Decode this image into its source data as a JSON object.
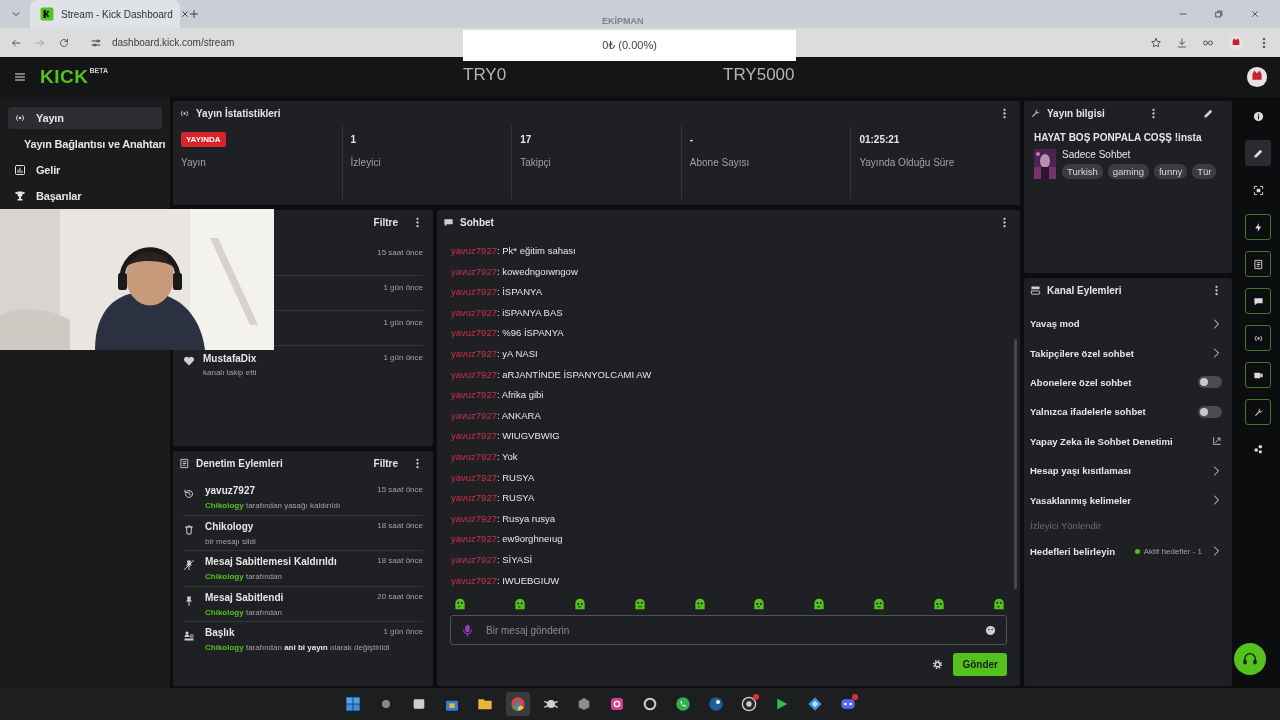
{
  "browser": {
    "tabs": [
      {
        "title": "Stream - Kick Dashboard",
        "selected": true
      }
    ],
    "nav_buttons": [
      {
        "kind": "back",
        "disabled": false
      },
      {
        "kind": "forward",
        "disabled": true
      },
      {
        "kind": "reload",
        "disabled": false
      }
    ],
    "url": "dashboard.kick.com/stream"
  },
  "overlay": {
    "label": "EKİPMAN",
    "progress_text": "0₺ (0.00%)",
    "level": 0,
    "min": "TRY0",
    "max": "TRY5000"
  },
  "header": {
    "logo": "KICK",
    "logo_badge": "BETA"
  },
  "sidebar": {
    "items": [
      {
        "kind": "stream",
        "label": "Yayın",
        "selected": true
      },
      {
        "kind": "sub",
        "label": "Yayın Bağlantısı ve Anahtarı",
        "selected": false
      },
      {
        "kind": "revenue",
        "label": "Gelir",
        "selected": false
      },
      {
        "kind": "achievements",
        "label": "Başarılar",
        "selected": false
      }
    ]
  },
  "stats": {
    "title": "Yayın İstatistikleri",
    "cells": [
      {
        "kind": "badge",
        "value": "YAYINDA",
        "label": "Yayın"
      },
      {
        "kind": "number",
        "value": "1",
        "label": "İzleyici"
      },
      {
        "kind": "number",
        "value": "17",
        "label": "Takipçi"
      },
      {
        "kind": "number",
        "value": "-",
        "label": "Abone Sayısı"
      },
      {
        "kind": "number",
        "value": "01:25:21",
        "label": "Yayında Olduğu Süre"
      }
    ]
  },
  "activity": {
    "filter": "Filtre",
    "items": [
      {
        "time": "15 saat önce"
      },
      {
        "time": "1 gün önce"
      },
      {
        "time": "1 gün önce"
      },
      {
        "name": "MustafaDix",
        "action": "kanalı takip etti",
        "time": "1 gün önce"
      }
    ]
  },
  "moderation": {
    "title": "Denetim Eylemleri",
    "filter": "Filtre",
    "items": [
      {
        "kind": "unban",
        "title": "yavuz7927",
        "actor": "Chikology",
        "detail": "tarafından yasağı kaldırıldı",
        "time": "15 saat önce"
      },
      {
        "kind": "delete",
        "title": "Chikology",
        "detail": "bir mesajı sildi",
        "time": "18 saat önce"
      },
      {
        "kind": "unpin",
        "title": "Mesaj Sabitlemesi Kaldırıldı",
        "actor": "Chikology",
        "detail": "tarafından",
        "time": "18 saat önce"
      },
      {
        "kind": "pin",
        "title": "Mesaj Sabitlendi",
        "actor": "Chikology",
        "detail": "tarafından",
        "time": "20 saat önce"
      },
      {
        "kind": "title",
        "title": "Başlık",
        "actor": "Chikology",
        "detail": "tarafından **ani bi yayın** olarak değiştirildi",
        "time": "1 gün önce"
      }
    ]
  },
  "chat": {
    "title": "Sohbet",
    "messages": [
      {
        "user": "yavuz7927",
        "text": ": Pk* eğitim sahası"
      },
      {
        "user": "yavuz7927",
        "text": ": kowedngoıwngow"
      },
      {
        "user": "yavuz7927",
        "text": ": İSPANYA"
      },
      {
        "user": "yavuz7927",
        "text": ": iSPANYA BAS"
      },
      {
        "user": "yavuz7927",
        "text": ": %96 İSPANYA"
      },
      {
        "user": "yavuz7927",
        "text": ": yA NASI"
      },
      {
        "user": "yavuz7927",
        "text": ": aRJANTİNDE İSPANYOLCAMI AW"
      },
      {
        "user": "yavuz7927",
        "text": ": Afrika gibi"
      },
      {
        "user": "yavuz7927",
        "text": ": ANKARA"
      },
      {
        "user": "yavuz7927",
        "text": ": WIUGVBWIG"
      },
      {
        "user": "yavuz7927",
        "text": ": Yok"
      },
      {
        "user": "yavuz7927",
        "text": ": RUSYA"
      },
      {
        "user": "yavuz7927",
        "text": ": RUSYA"
      },
      {
        "user": "yavuz7927",
        "text": ": Rusya rusya"
      },
      {
        "user": "yavuz7927",
        "text": ": ew9orghneıug"
      },
      {
        "user": "yavuz7927",
        "text": ": SİYASİ"
      },
      {
        "user": "yavuz7927",
        "text": ": IWUEBGIUW"
      }
    ],
    "placeholder": "Bir mesaj gönderin",
    "send": "Gönder"
  },
  "stream_info": {
    "title": "Yayın bilgisi",
    "stream_title": "HAYAT BOŞ PONPALA COŞŞ !insta",
    "category": "Sadece Sohbet",
    "tags": [
      "Turkish",
      "gaming",
      "funny",
      "Tür"
    ]
  },
  "channel_actions": {
    "title": "Kanal Eylemleri",
    "items": [
      {
        "kind": "chevron",
        "label": "Yavaş mod"
      },
      {
        "kind": "chevron",
        "label": "Takipçilere özel sohbet"
      },
      {
        "kind": "toggle",
        "label": "Abonelere özel sohbet",
        "on": false
      },
      {
        "kind": "toggle",
        "label": "Yalnızca ifadelerle sohbet",
        "on": false
      },
      {
        "kind": "external",
        "label": "Yapay Zeka ile Sohbet Denetimi"
      },
      {
        "kind": "chevron",
        "label": "Hesap yaşı kısıtlaması"
      },
      {
        "kind": "chevron",
        "label": "Yasaklanmış kelimeler"
      },
      {
        "kind": "section",
        "label": "İzleyici Yönlendir"
      },
      {
        "kind": "goal",
        "label": "Hedefleri belirleyin",
        "status": "Aktif hedefler - 1"
      }
    ]
  },
  "rail": {
    "buttons": [
      {
        "kind": "info",
        "outlined": false,
        "selected": false
      },
      {
        "kind": "edit",
        "outlined": false,
        "selected": true
      },
      {
        "kind": "focus",
        "outlined": false,
        "selected": false
      },
      {
        "kind": "bolt",
        "outlined": true,
        "selected": false
      },
      {
        "kind": "document",
        "outlined": true,
        "selected": false
      },
      {
        "kind": "chat",
        "outlined": true,
        "selected": false
      },
      {
        "kind": "broadcast",
        "outlined": true,
        "selected": false
      },
      {
        "kind": "video",
        "outlined": true,
        "selected": false
      },
      {
        "kind": "wrench",
        "outlined": true,
        "selected": false
      },
      {
        "kind": "dots",
        "outlined": false,
        "selected": false
      }
    ]
  },
  "taskbar": {
    "apps": [
      {
        "kind": "windows",
        "active": false,
        "notification": false
      },
      {
        "kind": "search",
        "active": false,
        "notification": false
      },
      {
        "kind": "taskview",
        "active": false,
        "notification": false
      },
      {
        "kind": "store",
        "active": false,
        "notification": false
      },
      {
        "kind": "folder",
        "active": false,
        "notification": false
      },
      {
        "kind": "chrome",
        "active": true,
        "notification": false
      },
      {
        "kind": "creature",
        "active": false,
        "notification": false
      },
      {
        "kind": "cube",
        "active": false,
        "notification": false
      },
      {
        "kind": "camera",
        "active": false,
        "notification": false
      },
      {
        "kind": "ring",
        "active": false,
        "notification": false
      },
      {
        "kind": "phone",
        "active": false,
        "notification": false
      },
      {
        "kind": "steam",
        "active": false,
        "notification": false
      },
      {
        "kind": "record",
        "active": false,
        "notification": true
      },
      {
        "kind": "play",
        "active": false,
        "notification": false
      },
      {
        "kind": "diamond",
        "active": false,
        "notification": false
      },
      {
        "kind": "gamepad",
        "active": false,
        "notification": true
      }
    ]
  }
}
